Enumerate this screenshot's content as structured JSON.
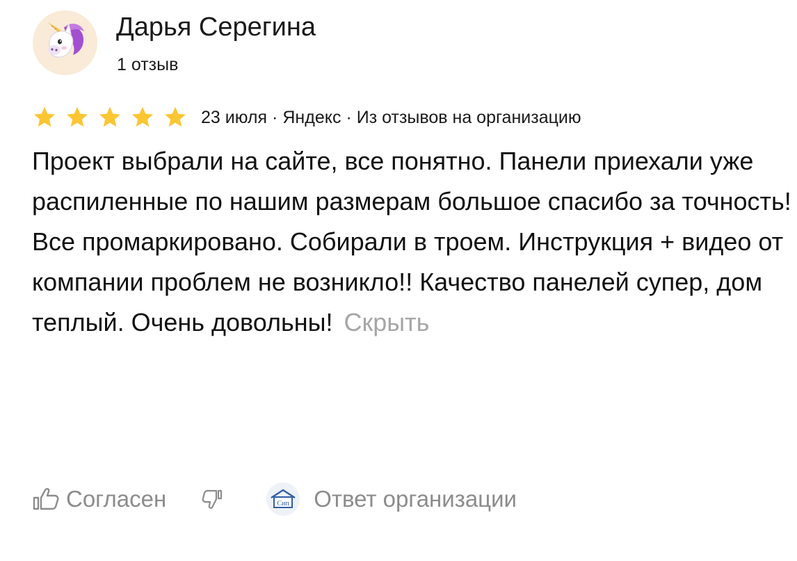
{
  "author": {
    "name": "Дарья Серегина",
    "reviews_count": "1 отзыв",
    "avatar_icon": "unicorn-icon"
  },
  "review": {
    "rating": 5,
    "rating_max": 5,
    "date": "23 июля",
    "separator": "·",
    "source": "Яндекс",
    "origin": "Из отзывов на организацию",
    "text": "Проект выбрали на сайте, все понятно. Панели приехали уже распиленные по нашим размерам большое спасибо за точность! Все промаркировано. Собирали в троем. Инструкция + видео от компании проблем не возникло!! Качество панелей супер, дом теплый. Очень довольны!",
    "hide_label": "Скрыть"
  },
  "actions": {
    "agree_label": "Согласен",
    "org_logo_text": "Сип",
    "org_reply_label": "Ответ организации"
  },
  "colors": {
    "star": "#fcc633",
    "text": "#111111",
    "muted": "#8c8c8c",
    "hide_link": "#a6a6a6",
    "avatar_bg": "#f9ebd7"
  }
}
